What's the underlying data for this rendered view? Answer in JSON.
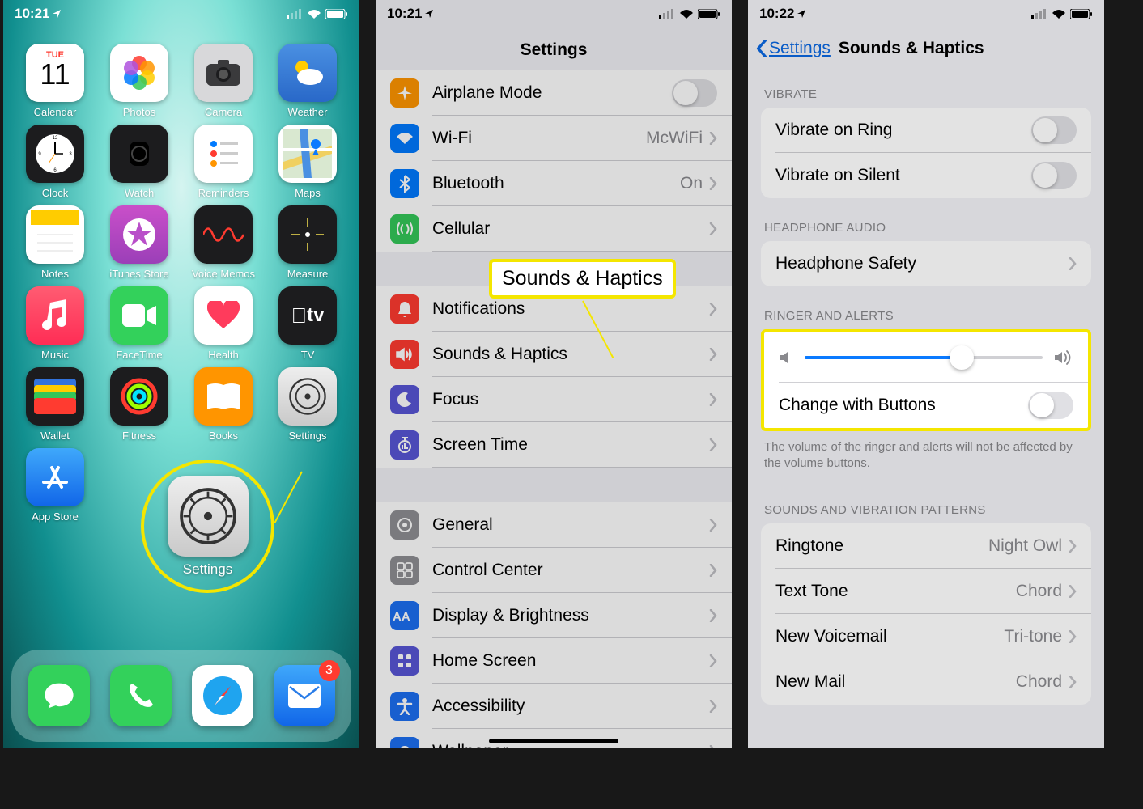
{
  "p1": {
    "time": "10:21",
    "apps": [
      [
        "Calendar",
        "TUE",
        "11"
      ],
      [
        "Photos",
        ""
      ],
      [
        "Camera",
        ""
      ],
      [
        "Weather",
        ""
      ],
      [
        "Clock",
        ""
      ],
      [
        "Watch",
        ""
      ],
      [
        "Reminders",
        ""
      ],
      [
        "Maps",
        ""
      ],
      [
        "Notes",
        ""
      ],
      [
        "iTunes Store",
        ""
      ],
      [
        "Voice Memos",
        ""
      ],
      [
        "Measure",
        ""
      ],
      [
        "Music",
        ""
      ],
      [
        "FaceTime",
        ""
      ],
      [
        "Health",
        ""
      ],
      [
        "TV",
        ""
      ],
      [
        "Wallet",
        ""
      ],
      [
        "Fitness",
        ""
      ],
      [
        "Books",
        ""
      ],
      [
        "Settings",
        ""
      ],
      [
        "App Store",
        ""
      ]
    ],
    "highlight": "Settings",
    "badge": "3"
  },
  "p2": {
    "time": "10:21",
    "title": "Settings",
    "callout": "Sounds & Haptics",
    "g1": [
      [
        "Airplane Mode",
        "",
        "bo",
        "toggle"
      ],
      [
        "Wi-Fi",
        "McWiFi",
        "bb",
        "chev"
      ],
      [
        "Bluetooth",
        "On",
        "bb",
        "chev"
      ],
      [
        "Cellular",
        "",
        "bg",
        "chev"
      ]
    ],
    "g2": [
      [
        "Notifications",
        "",
        "br",
        "chev"
      ],
      [
        "Sounds & Haptics",
        "",
        "br",
        "chev"
      ],
      [
        "Focus",
        "",
        "bp",
        "chev"
      ],
      [
        "Screen Time",
        "",
        "bp",
        "chev"
      ]
    ],
    "g3": [
      [
        "General",
        "",
        "bgy",
        "chev"
      ],
      [
        "Control Center",
        "",
        "bgy",
        "chev"
      ],
      [
        "Display & Brightness",
        "",
        "bdb",
        "chev"
      ],
      [
        "Home Screen",
        "",
        "bp",
        "chev"
      ],
      [
        "Accessibility",
        "",
        "bdb",
        "chev"
      ],
      [
        "Wallpaper",
        "",
        "bdb",
        "chev"
      ]
    ]
  },
  "p3": {
    "time": "10:22",
    "back": "Settings",
    "title": "Sounds & Haptics",
    "s_vibrate": "VIBRATE",
    "vibrate": [
      [
        "Vibrate on Ring"
      ],
      [
        "Vibrate on Silent"
      ]
    ],
    "s_headphone": "HEADPHONE AUDIO",
    "headphone": "Headphone Safety",
    "s_ringer": "RINGER AND ALERTS",
    "cwb": "Change with Buttons",
    "slider": 66,
    "foot": "The volume of the ringer and alerts will not be affected by the volume buttons.",
    "s_sounds": "SOUNDS AND VIBRATION PATTERNS",
    "sounds": [
      [
        "Ringtone",
        "Night Owl"
      ],
      [
        "Text Tone",
        "Chord"
      ],
      [
        "New Voicemail",
        "Tri-tone"
      ],
      [
        "New Mail",
        "Chord"
      ]
    ]
  }
}
